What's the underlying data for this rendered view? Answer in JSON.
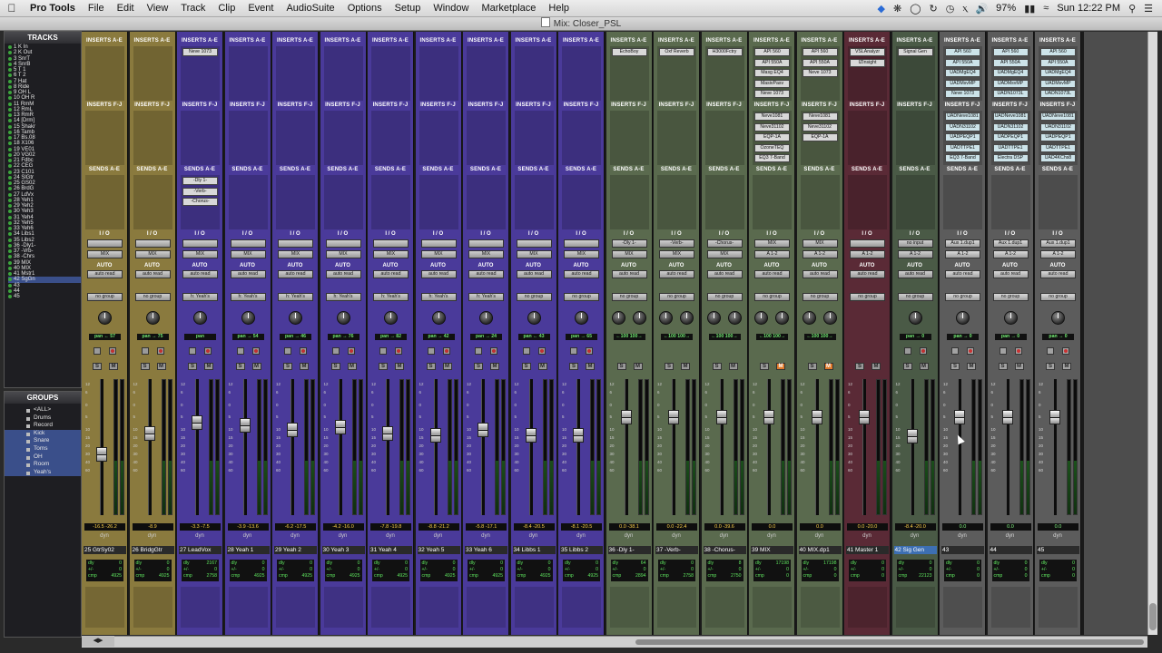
{
  "menubar": {
    "app": "Pro Tools",
    "items": [
      "File",
      "Edit",
      "View",
      "Track",
      "Clip",
      "Event",
      "AudioSuite",
      "Options",
      "Setup",
      "Window",
      "Marketplace",
      "Help"
    ],
    "battery": "97%",
    "clock": "Sun 12:22 PM"
  },
  "window": {
    "title": "Mix: Closer_PSL"
  },
  "tracks_panel": {
    "title": "TRACKS",
    "tracks": [
      "1 K In",
      "2 K Out",
      "3 SnrT",
      "4 SnrB",
      "5 T 1",
      "6 T 2",
      "7 Hat",
      "8 Ride",
      "9 OH L",
      "10 OH R",
      "11 RmM",
      "12 RmL",
      "13 RmR",
      "14 [Drm]",
      "15 Shakr",
      "16 Tamb",
      "17 Bs.08",
      "18 X106",
      "19 VE01",
      "20 VG02",
      "21 Fdbc",
      "22 CEG",
      "23 C101",
      "24 SlGtr",
      "25 GS02",
      "26 BrdG",
      "27 LdVx",
      "28 Yeh1",
      "29 Yeh2",
      "30 Yeh3",
      "31 Yeh4",
      "32 Yeh5",
      "33 Yeh6",
      "34 Libs1",
      "35 Libs2",
      "36 -Dly1-",
      "37 -Vrb-",
      "38 -Chrs",
      "39 MIX",
      "40 MIX",
      "41 Mstr1",
      "42 SgGn",
      "43",
      "44",
      "45"
    ]
  },
  "groups_panel": {
    "title": "GROUPS",
    "groups": [
      "<ALL>",
      "Drums",
      "Record",
      "Kick",
      "Snare",
      "Toms",
      "OH",
      "Room",
      "Yeah's"
    ]
  },
  "mixer": {
    "strips": [
      {
        "name": "25 GtrSy02",
        "color": "#8a7a3e",
        "inserts": [],
        "inserts_fj": [],
        "sends": [],
        "io_top": "",
        "io_mid": "MIX",
        "auto": "auto read",
        "group": "no group",
        "pan": "pan  ← 57",
        "vol": "-16.5  -26.2",
        "delay": [
          "dly",
          "0",
          "+/-",
          "0",
          "cmp",
          "4925"
        ],
        "fader": 0.55,
        "knobs": 1
      },
      {
        "name": "26 BridgGtr",
        "color": "#8a7a3e",
        "inserts": [],
        "inserts_fj": [],
        "sends": [],
        "io_top": "",
        "io_mid": "MIX",
        "auto": "auto read",
        "group": "no group",
        "pan": "pan  → 75",
        "vol": "-8.9",
        "delay": [
          "dly",
          "0",
          "+/-",
          "0",
          "cmp",
          "4925"
        ],
        "fader": 0.4,
        "knobs": 1
      },
      {
        "name": "27 LeadVox",
        "color": "#4a3a9a",
        "inserts": [
          "Neve 1073"
        ],
        "inserts_fj": [],
        "sends": [
          "-Dly 1-",
          "-Verb-",
          "-Chorus-"
        ],
        "io_top": "",
        "io_mid": "MIX",
        "auto": "auto read",
        "group": "h: Yeah's",
        "pan": "pan",
        "vol": "-3.3  -7.5",
        "delay": [
          "dly",
          "2167",
          "+/-",
          "0",
          "cmp",
          "2758"
        ],
        "fader": 0.32,
        "knobs": 1
      },
      {
        "name": "28 Yeah 1",
        "color": "#4a3a9a",
        "inserts": [],
        "inserts_fj": [],
        "sends": [],
        "io_top": "",
        "io_mid": "MIX",
        "auto": "auto read",
        "group": "h: Yeah's",
        "pan": "pan  → 54",
        "vol": "-3.9  -13.6",
        "delay": [
          "dly",
          "0",
          "+/-",
          "0",
          "cmp",
          "4925"
        ],
        "fader": 0.34,
        "knobs": 1
      },
      {
        "name": "29 Yeah 2",
        "color": "#4a3a9a",
        "inserts": [],
        "inserts_fj": [],
        "sends": [],
        "io_top": "",
        "io_mid": "MIX",
        "auto": "auto read",
        "group": "h: Yeah's",
        "pan": "pan  → 46",
        "vol": "-6.2  -17.5",
        "delay": [
          "dly",
          "0",
          "+/-",
          "0",
          "cmp",
          "4925"
        ],
        "fader": 0.37,
        "knobs": 1
      },
      {
        "name": "30 Yeah 3",
        "color": "#4a3a9a",
        "inserts": [],
        "inserts_fj": [],
        "sends": [],
        "io_top": "",
        "io_mid": "MIX",
        "auto": "auto read",
        "group": "h: Yeah's",
        "pan": "pan  → 76",
        "vol": "-4.2  -16.0",
        "delay": [
          "dly",
          "0",
          "+/-",
          "0",
          "cmp",
          "4925"
        ],
        "fader": 0.35,
        "knobs": 1
      },
      {
        "name": "31 Yeah 4",
        "color": "#4a3a9a",
        "inserts": [],
        "inserts_fj": [],
        "sends": [],
        "io_top": "",
        "io_mid": "MIX",
        "auto": "auto read",
        "group": "h: Yeah's",
        "pan": "pan  → 82",
        "vol": "-7.8  -19.8",
        "delay": [
          "dly",
          "0",
          "+/-",
          "0",
          "cmp",
          "4925"
        ],
        "fader": 0.4,
        "knobs": 1
      },
      {
        "name": "32 Yeah 5",
        "color": "#4a3a9a",
        "inserts": [],
        "inserts_fj": [],
        "sends": [],
        "io_top": "",
        "io_mid": "MIX",
        "auto": "auto read",
        "group": "h: Yeah's",
        "pan": "pan  → 42",
        "vol": "-8.8  -21.2",
        "delay": [
          "dly",
          "0",
          "+/-",
          "0",
          "cmp",
          "4925"
        ],
        "fader": 0.41,
        "knobs": 1
      },
      {
        "name": "33 Yeah 6",
        "color": "#4a3a9a",
        "inserts": [],
        "inserts_fj": [],
        "sends": [],
        "io_top": "",
        "io_mid": "MIX",
        "auto": "auto read",
        "group": "h: Yeah's",
        "pan": "pan  → 24",
        "vol": "-5.8  -17.1",
        "delay": [
          "dly",
          "0",
          "+/-",
          "0",
          "cmp",
          "4925"
        ],
        "fader": 0.37,
        "knobs": 1
      },
      {
        "name": "34 Libbs 1",
        "color": "#4a3a9a",
        "inserts": [],
        "inserts_fj": [],
        "sends": [],
        "io_top": "",
        "io_mid": "MIX",
        "auto": "auto read",
        "group": "no group",
        "pan": "pan  ← 43",
        "vol": "-8.4  -20.5",
        "delay": [
          "dly",
          "0",
          "+/-",
          "0",
          "cmp",
          "4925"
        ],
        "fader": 0.41,
        "knobs": 1
      },
      {
        "name": "35 Libbs 2",
        "color": "#4a3a9a",
        "inserts": [],
        "inserts_fj": [],
        "sends": [],
        "io_top": "",
        "io_mid": "MIX",
        "auto": "auto read",
        "group": "no group",
        "pan": "pan  → 65",
        "vol": "-8.1  -20.5",
        "delay": [
          "dly",
          "0",
          "+/-",
          "0",
          "cmp",
          "4925"
        ],
        "fader": 0.41,
        "knobs": 1
      },
      {
        "name": "36 -Dly 1-",
        "color": "#5a6a4e",
        "inserts": [
          "EchoBoy"
        ],
        "inserts_fj": [],
        "sends": [],
        "io_top": "-Dly 1-",
        "io_mid": "MIX",
        "auto": "auto read",
        "group": "no group",
        "pan": "←100  100→",
        "vol": "0.0  -38.1",
        "delay": [
          "dly",
          "64",
          "+/-",
          "0",
          "cmp",
          "2894"
        ],
        "fader": 0.28,
        "knobs": 2
      },
      {
        "name": "37 -Verb-",
        "color": "#5a6a4e",
        "inserts": [
          "Oxf Reverb"
        ],
        "inserts_fj": [],
        "sends": [],
        "io_top": "-Verb-",
        "io_mid": "MIX",
        "auto": "auto read",
        "group": "no group",
        "pan": "←100  100→",
        "vol": "0.0  -22.4",
        "delay": [
          "dly",
          "0",
          "+/-",
          "0",
          "cmp",
          "2758"
        ],
        "fader": 0.28,
        "knobs": 2
      },
      {
        "name": "38 -Chorus-",
        "color": "#5a6a4e",
        "inserts": [
          "H3000Fctry"
        ],
        "inserts_fj": [],
        "sends": [],
        "io_top": "-Chorus-",
        "io_mid": "MIX",
        "auto": "auto read",
        "group": "no group",
        "pan": "←100  100→",
        "vol": "0.0  -39.6",
        "delay": [
          "dly",
          "8",
          "+/-",
          "0",
          "cmp",
          "2750"
        ],
        "fader": 0.28,
        "knobs": 2
      },
      {
        "name": "39 MIX",
        "color": "#5a6a4e",
        "inserts": [
          "API 560",
          "API 550A",
          "Masg EQ4",
          "MasivPasv",
          "Neve 1073"
        ],
        "inserts_fj": [
          "Neve1081",
          "Neve31102",
          "EQP-1A",
          "OzoneTEQ",
          "EQ3 7-Band"
        ],
        "sends": [],
        "io_top": "MIX",
        "io_mid": "A 1-2",
        "auto": "auto read",
        "group": "no group",
        "pan": "←100  100→",
        "vol": "0.0",
        "delay": [
          "dly",
          "17198",
          "+/-",
          "0",
          "cmp",
          "0"
        ],
        "fader": 0.28,
        "knobs": 2,
        "muted": true
      },
      {
        "name": "40 MIX.dp1",
        "color": "#5a6a4e",
        "inserts": [
          "API 560",
          "API 550A",
          "Neve 1073"
        ],
        "inserts_fj": [
          "Neve1081",
          "Neve31102",
          "EQP-1A"
        ],
        "sends": [],
        "io_top": "MIX",
        "io_mid": "A 1-2",
        "auto": "auto read",
        "group": "no group",
        "pan": "←100  100→",
        "vol": "0.0",
        "delay": [
          "dly",
          "17198",
          "+/-",
          "0",
          "cmp",
          "0"
        ],
        "fader": 0.28,
        "knobs": 2,
        "muted": true
      },
      {
        "name": "41 Master 1",
        "color": "#5a2a36",
        "inserts": [
          "VSLAnalyzr",
          "IZInsight"
        ],
        "inserts_fj": [],
        "sends": [],
        "io_top": "",
        "io_mid": "A 1-2",
        "auto": "auto read",
        "group": "no group",
        "pan": "",
        "vol": "0.0  -20.0",
        "delay": [
          "dly",
          "0",
          "+/-",
          "0",
          "cmp",
          "0"
        ],
        "fader": 0.28,
        "knobs": 0
      },
      {
        "name": "42 Sig Gen",
        "color": "#4a5a46",
        "inserts": [
          "Signal Gen"
        ],
        "inserts_fj": [],
        "sends": [],
        "io_top": "no input",
        "io_mid": "A 1-2",
        "auto": "auto read",
        "group": "no group",
        "pan": "pan  → 0",
        "vol": "-8.4  -20.0",
        "delay": [
          "dly",
          "0",
          "+/-",
          "0",
          "cmp",
          "22123"
        ],
        "fader": 0.42,
        "knobs": 1,
        "highlight": true
      },
      {
        "name": "43",
        "color": "#585858",
        "inserts": [
          "API 560",
          "API 550A",
          "UADMgEQ4",
          "UADMsvMP",
          "Neve 1073"
        ],
        "inserts_fj": [
          "UADNeve1081",
          "UADN31102",
          "UADPEQP1",
          "UADTTPE1",
          "EQ3 7-Band"
        ],
        "sends": [],
        "io_top": "Aux 1.dup1",
        "io_mid": "A 1-2",
        "auto": "auto read",
        "group": "no group",
        "pan": "pan  → 0",
        "vol": "0.0",
        "delay": [
          "dly",
          "0",
          "+/-",
          "0",
          "cmp",
          "0"
        ],
        "fader": 0.28,
        "knobs": 1,
        "dim": true
      },
      {
        "name": "44",
        "color": "#585858",
        "inserts": [
          "API 560",
          "API 550A",
          "UADMgEQ4",
          "UADMsvMP",
          "UADN1073L"
        ],
        "inserts_fj": [
          "UADNeve1081",
          "UADN31102",
          "UADPEQP1",
          "UADTTPE1",
          "Electra DSP"
        ],
        "sends": [],
        "io_top": "Aux 1.dup1",
        "io_mid": "A 1-2",
        "auto": "auto read",
        "group": "no group",
        "pan": "pan  → 0",
        "vol": "0.0",
        "delay": [
          "dly",
          "0",
          "+/-",
          "0",
          "cmp",
          "0"
        ],
        "fader": 0.28,
        "knobs": 1,
        "dim": true
      },
      {
        "name": "45",
        "color": "#585858",
        "inserts": [
          "API 560",
          "API 550A",
          "UADMgEQ4",
          "UADMsvMP",
          "UADN1073L"
        ],
        "inserts_fj": [
          "UADNeve1081",
          "UADN31102",
          "UADPEQP1",
          "UADTTPE1",
          "UAD4KChs8"
        ],
        "sends": [],
        "io_top": "Aux 1.dup1",
        "io_mid": "A 1-2",
        "auto": "auto read",
        "group": "no group",
        "pan": "pan  → 0",
        "vol": "0.0",
        "delay": [
          "dly",
          "0",
          "+/-",
          "0",
          "cmp",
          "0"
        ],
        "fader": 0.28,
        "knobs": 1,
        "dim": true
      }
    ],
    "labels": {
      "inserts_ae": "INSERTS A-E",
      "inserts_fj": "INSERTS F-J",
      "sends_ae": "SENDS A-E",
      "io": "I / O",
      "auto": "AUTO",
      "dyn": "dyn"
    }
  }
}
